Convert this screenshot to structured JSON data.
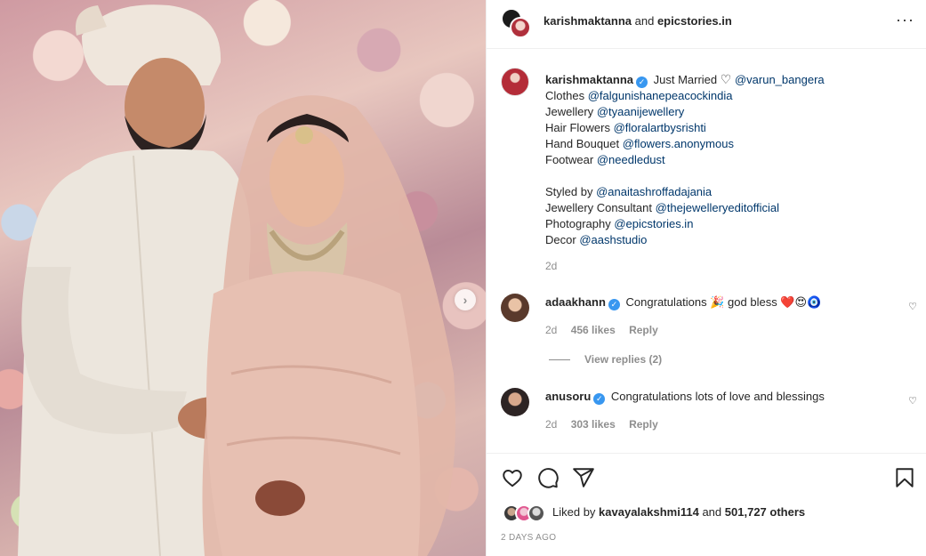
{
  "header": {
    "user1": "karishmaktanna",
    "connector": "and",
    "user2": "epicstories.in"
  },
  "caption": {
    "username": "karishmaktanna",
    "intro": "Just Married",
    "partner": "@varun_bangera",
    "lines": [
      {
        "label": "Clothes",
        "mention": "@falgunishanepeacockindia"
      },
      {
        "label": "Jewellery",
        "mention": "@tyaanijewellery"
      },
      {
        "label": "Hair Flowers",
        "mention": "@floralartbysrishti"
      },
      {
        "label": "Hand Bouquet",
        "mention": "@flowers.anonymous"
      },
      {
        "label": "Footwear",
        "mention": "@needledust"
      },
      {
        "label": "Styled by",
        "mention": "@anaitashroffadajania"
      },
      {
        "label": "Jewellery Consultant",
        "mention": "@thejewelleryeditofficial"
      },
      {
        "label": "Photography",
        "mention": "@epicstories.in"
      },
      {
        "label": "Decor",
        "mention": "@aashstudio"
      }
    ],
    "time": "2d"
  },
  "comments": [
    {
      "username": "adaakhann",
      "text": "Congratulations",
      "text2": "god bless",
      "emoji1": "🎉",
      "emoji2": "❤️😍🧿",
      "time": "2d",
      "likes": "456 likes",
      "reply": "Reply",
      "view_replies": "View replies (2)"
    },
    {
      "username": "anusoru",
      "text": "Congratulations lots of love and blessings",
      "time": "2d",
      "likes": "303 likes",
      "reply": "Reply"
    }
  ],
  "footer": {
    "liked_by_prefix": "Liked by",
    "liked_by_user": "kavayalakshmi114",
    "and": "and",
    "others": "501,727 others",
    "post_time": "2 DAYS AGO"
  },
  "icons": {
    "more": "more-options-icon",
    "like": "heart-icon",
    "comment": "comment-icon",
    "share": "share-icon",
    "save": "bookmark-icon",
    "next": "chevron-right-icon"
  }
}
